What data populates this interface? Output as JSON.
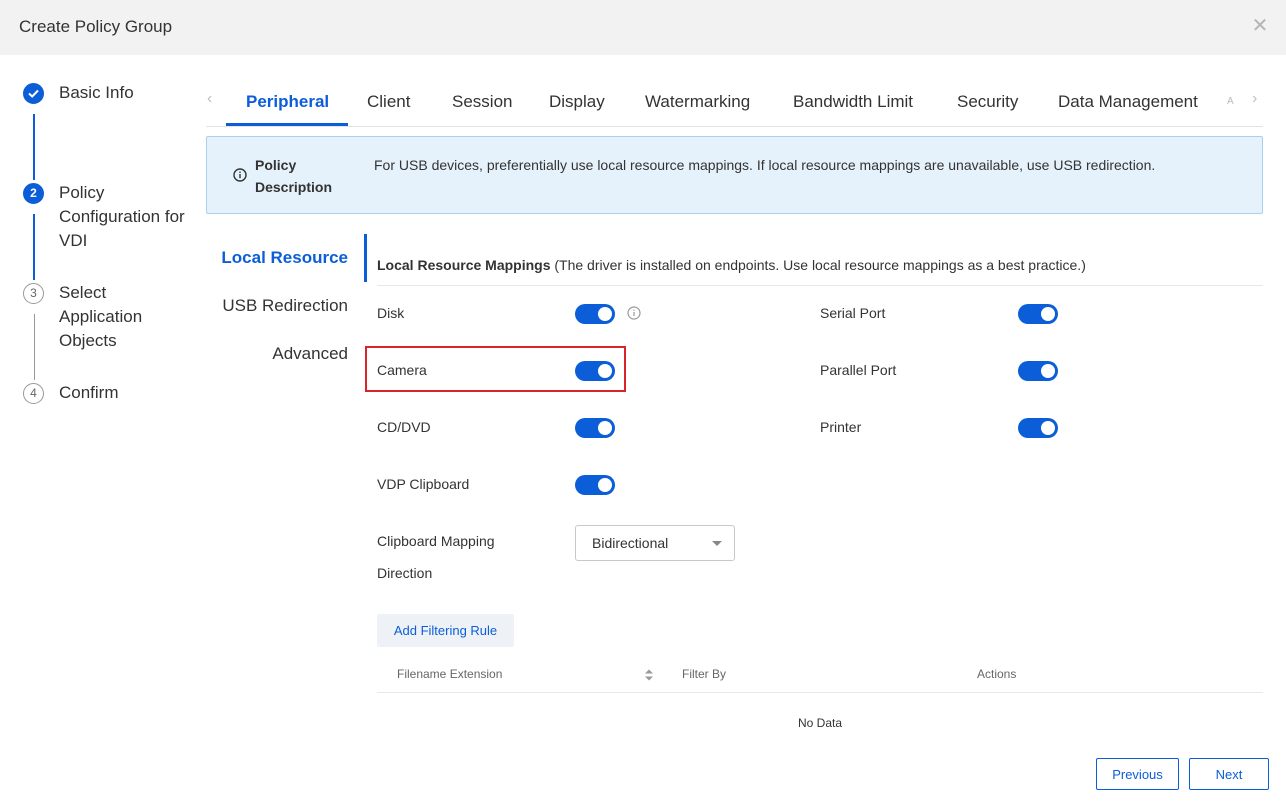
{
  "dialog": {
    "title": "Create Policy Group"
  },
  "steps": [
    {
      "num": "✓",
      "label": "Basic Info"
    },
    {
      "num": "2",
      "label": "Policy Configuration for VDI"
    },
    {
      "num": "3",
      "label": "Select Application Objects"
    },
    {
      "num": "4",
      "label": "Confirm"
    }
  ],
  "tabs": [
    "Peripheral",
    "Client",
    "Session",
    "Display",
    "Watermarking",
    "Bandwidth Limit",
    "Security",
    "Data Management"
  ],
  "tab_overflow": "A",
  "description": {
    "label": "Policy Description",
    "text": "For USB devices, preferentially use local resource mappings. If local resource mappings are unavailable, use USB redirection."
  },
  "subnav": [
    "Local Resource",
    "USB Redirection",
    "Advanced"
  ],
  "section": {
    "title": "Local Resource Mappings",
    "note": " (The driver is installed on endpoints. Use local resource mappings as a best practice.)"
  },
  "fields": {
    "disk": {
      "label": "Disk",
      "on": true
    },
    "camera": {
      "label": "Camera",
      "on": true
    },
    "cddvd": {
      "label": "CD/DVD",
      "on": true
    },
    "vdp_clipboard": {
      "label": "VDP Clipboard",
      "on": true
    },
    "serial_port": {
      "label": "Serial Port",
      "on": true
    },
    "parallel_port": {
      "label": "Parallel Port",
      "on": true
    },
    "printer": {
      "label": "Printer",
      "on": true
    },
    "clipboard_direction": {
      "label_line1": "Clipboard Mapping",
      "label_line2": "Direction",
      "value": "Bidirectional"
    }
  },
  "filter": {
    "add_button": "Add Filtering Rule",
    "columns": [
      "Filename Extension",
      "Filter By",
      "Actions"
    ],
    "empty": "No Data"
  },
  "footer": {
    "previous": "Previous",
    "next": "Next"
  },
  "colors": {
    "primary": "#0b5ed7",
    "highlight": "#d9242b",
    "info_bg": "#e6f2fb"
  }
}
